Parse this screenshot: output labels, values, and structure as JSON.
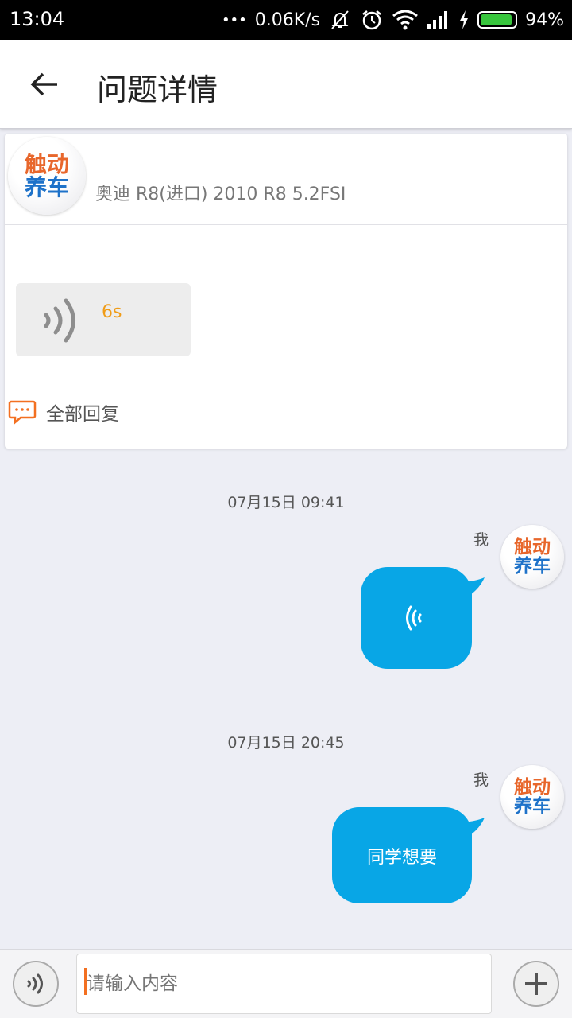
{
  "status_bar": {
    "time": "13:04",
    "dots": "•••",
    "net_speed": "0.06K/s",
    "battery_text": "94%",
    "battery_level": 0.94,
    "icons": [
      "silent-icon",
      "alarm-icon",
      "wifi-icon",
      "signal-icon",
      "charging-icon",
      "battery-icon"
    ]
  },
  "header": {
    "title": "问题详情",
    "back_icon": "back-arrow-icon"
  },
  "question": {
    "avatar_line1": "触动",
    "avatar_line2": "养车",
    "car_model": "奥迪 R8(进口) 2010 R8 5.2FSI",
    "voice_duration": "6s",
    "all_replies_label": "全部回复"
  },
  "messages": [
    {
      "time": "07月15日 09:41",
      "sender": "我",
      "type": "voice",
      "avatar_line1": "触动",
      "avatar_line2": "养车"
    },
    {
      "time": "07月15日 20:45",
      "sender": "我",
      "type": "text",
      "text": "同学想要",
      "avatar_line1": "触动",
      "avatar_line2": "养车"
    }
  ],
  "input": {
    "placeholder": "请输入内容"
  },
  "colors": {
    "bubble": "#08a6e6",
    "accent_orange": "#f09c17",
    "background": "#edeef5"
  }
}
